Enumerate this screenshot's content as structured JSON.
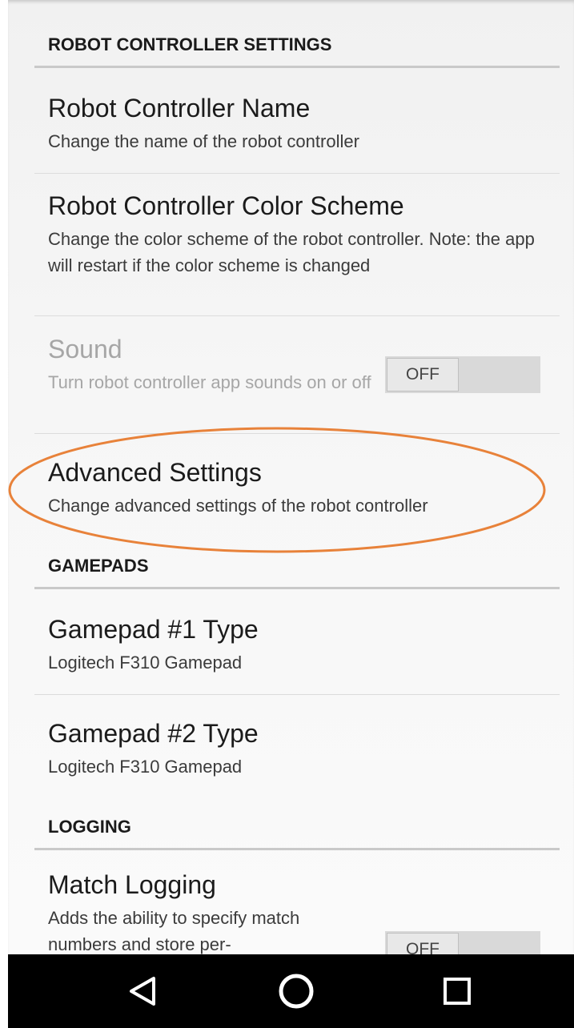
{
  "sections": {
    "robot_controller": {
      "header": "ROBOT CONTROLLER SETTINGS",
      "items": [
        {
          "title": "Robot Controller Name",
          "summary": "Change the name of the robot controller"
        },
        {
          "title": "Robot Controller Color Scheme",
          "summary": "Change the color scheme of the robot controller. Note: the app will restart if the color scheme is changed"
        },
        {
          "title": "Sound",
          "summary": "Turn robot controller app sounds on or off",
          "toggle": "OFF",
          "enabled": false
        },
        {
          "title": "Advanced Settings",
          "summary": "Change advanced settings of the robot controller"
        }
      ]
    },
    "gamepads": {
      "header": "GAMEPADS",
      "items": [
        {
          "title": "Gamepad #1 Type",
          "summary": "Logitech F310 Gamepad"
        },
        {
          "title": "Gamepad #2 Type",
          "summary": "Logitech F310 Gamepad"
        }
      ]
    },
    "logging": {
      "header": "LOGGING",
      "items": [
        {
          "title": "Match Logging",
          "summary": "Adds the ability to specify match numbers and store per-",
          "toggle": "OFF"
        }
      ]
    }
  },
  "annotation": {
    "color": "#e8823a",
    "target": "Advanced Settings"
  },
  "navbar": {
    "back_icon": "back-triangle-icon",
    "home_icon": "home-circle-icon",
    "recents_icon": "recents-square-icon"
  }
}
